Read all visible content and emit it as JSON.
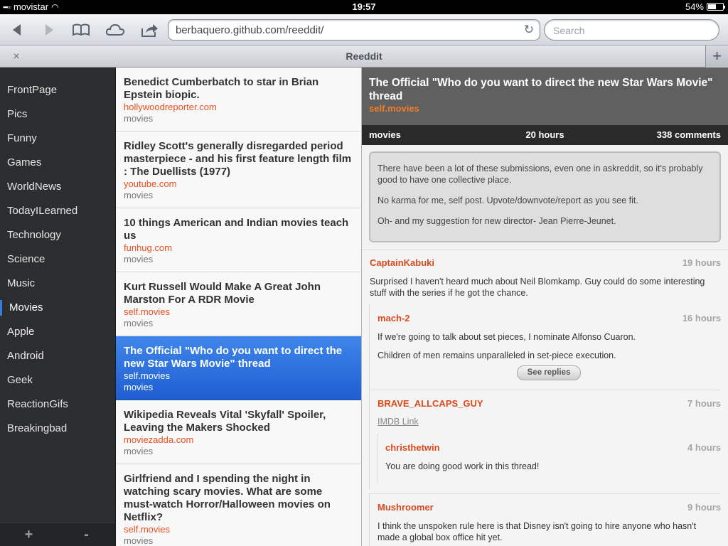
{
  "status": {
    "carrier": "movistar",
    "time": "19:57",
    "battery": "54%",
    "battery_level": 0.54
  },
  "browser": {
    "url": "berbaquero.github.com/reeddit/",
    "search_placeholder": "Search",
    "tab_title": "Reeddit",
    "tab_close": "×",
    "tab_add": "+",
    "icons": [
      "back-icon",
      "forward-icon",
      "bookmarks-icon",
      "cloud-icon",
      "share-icon",
      "reload-icon"
    ]
  },
  "sidebar": {
    "items": [
      {
        "label": "FrontPage"
      },
      {
        "label": "Pics"
      },
      {
        "label": "Funny"
      },
      {
        "label": "Games"
      },
      {
        "label": "WorldNews"
      },
      {
        "label": "TodayILearned"
      },
      {
        "label": "Technology"
      },
      {
        "label": "Science"
      },
      {
        "label": "Music"
      },
      {
        "label": "Movies",
        "active": true
      },
      {
        "label": "Apple"
      },
      {
        "label": "Android"
      },
      {
        "label": "Geek"
      },
      {
        "label": "ReactionGifs"
      },
      {
        "label": "Breakingbad"
      }
    ],
    "add_label": "+",
    "remove_label": "-"
  },
  "posts": [
    {
      "title": "Benedict Cumberbatch to star in Brian Epstein biopic.",
      "domain": "hollywoodreporter.com",
      "subreddit": "movies"
    },
    {
      "title": "Ridley Scott's generally disregarded period masterpiece - and his first feature length film : The Duellists (1977)",
      "domain": "youtube.com",
      "subreddit": "movies"
    },
    {
      "title": "10 things American and Indian movies teach us",
      "domain": "funhug.com",
      "subreddit": "movies"
    },
    {
      "title": "Kurt Russell Would Make A Great John Marston For A RDR Movie",
      "domain": "self.movies",
      "subreddit": "movies"
    },
    {
      "title": "The Official \"Who do you want to direct the new Star Wars Movie\" thread",
      "domain": "self.movies",
      "subreddit": "movies",
      "selected": true
    },
    {
      "title": "Wikipedia Reveals Vital 'Skyfall' Spoiler, Leaving the Makers Shocked",
      "domain": "moviezadda.com",
      "subreddit": "movies"
    },
    {
      "title": "Girlfriend and I spending the night in watching scary movies. What are some must-watch Horror/Halloween movies on Netflix?",
      "domain": "self.movies",
      "subreddit": "movies"
    }
  ],
  "detail": {
    "title": "The Official \"Who do you want to direct the new Star Wars Movie\" thread",
    "domain": "self.movies",
    "subreddit": "movies",
    "age": "20 hours",
    "comments_count": "338 comments",
    "selftext": [
      "There have been a lot of these submissions, even one in askreddit, so it's probably good to have one collective place.",
      "No karma for me, self post. Upvote/downvote/report as you see fit.",
      "Oh- and my suggestion for new director- Jean Pierre-Jeunet."
    ],
    "comments": {
      "c1": {
        "author": "CaptainKabuki",
        "age": "19 hours",
        "body": "Surprised I haven't heard much about Neil Blomkamp. Guy could do some interesting stuff with the series if he got the chance."
      },
      "c2": {
        "author": "mach-2",
        "age": "16 hours",
        "body1": "If we're going to talk about set pieces, I nominate Alfonso Cuaron.",
        "body2": "Children of men remains unparalleled in set-piece execution.",
        "see_replies": "See replies"
      },
      "c3": {
        "author": "BRAVE_ALLCAPS_GUY",
        "age": "7 hours",
        "link": "IMDB Link"
      },
      "c4": {
        "author": "christhetwin",
        "age": "4 hours",
        "body": "You are doing good work in this thread!"
      },
      "c5": {
        "author": "Mushroomer",
        "age": "9 hours",
        "body": "I think the unspoken rule here is that Disney isn't going to hire anyone who hasn't made a global box office hit yet."
      }
    }
  }
}
